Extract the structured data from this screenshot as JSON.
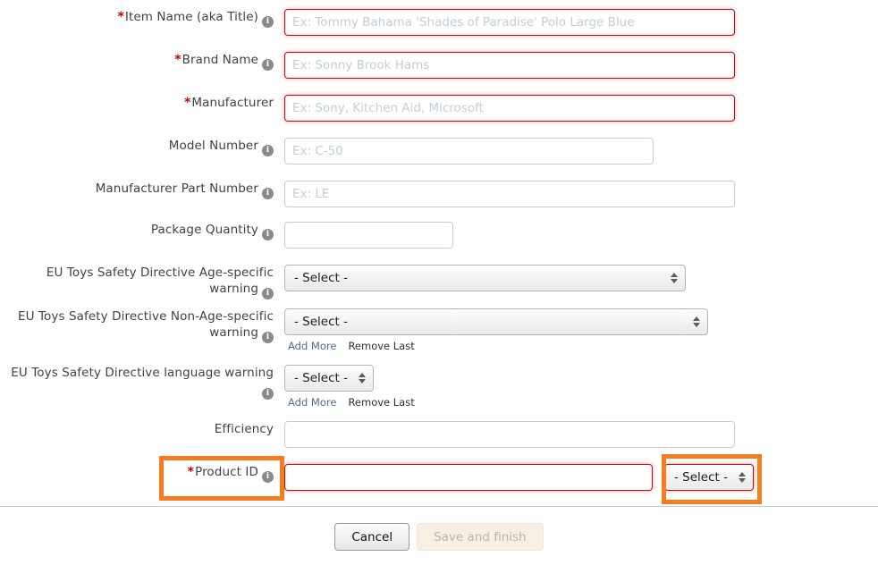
{
  "form": {
    "rows": [
      {
        "id": "item-name",
        "label": "Item Name (aka Title)",
        "required": true,
        "info": true,
        "control": "text",
        "placeholder": "Ex: Tommy Bahama 'Shades of Paradise' Polo Large Blue",
        "value": "",
        "invalid": true
      },
      {
        "id": "brand-name",
        "label": "Brand Name",
        "required": true,
        "info": true,
        "control": "text",
        "placeholder": "Ex: Sonny Brook Hams",
        "value": "",
        "invalid": true
      },
      {
        "id": "manufacturer",
        "label": "Manufacturer",
        "required": true,
        "info": true,
        "control": "text",
        "placeholder": "Ex: Sony, Kitchen Aid, Microsoft",
        "value": "",
        "invalid": true
      },
      {
        "id": "model-number",
        "label": "Model Number",
        "required": false,
        "info": true,
        "control": "text",
        "placeholder": "Ex: C-50",
        "value": "",
        "invalid": false
      },
      {
        "id": "manufacturer-part-number",
        "label": "Manufacturer Part Number",
        "required": false,
        "info": true,
        "control": "text",
        "placeholder": "Ex: LE",
        "value": "",
        "invalid": false
      },
      {
        "id": "package-quantity",
        "label": "Package Quantity",
        "required": false,
        "info": true,
        "control": "text",
        "placeholder": "",
        "value": "",
        "invalid": false
      },
      {
        "id": "eu-toys-age-specific-warning",
        "label": "EU Toys Safety Directive Age-specific warning",
        "required": false,
        "info": true,
        "control": "select",
        "selected": "- Select -",
        "invalid": false
      },
      {
        "id": "eu-toys-non-age-specific-warning",
        "label": "EU Toys Safety Directive Non-Age-specific warning",
        "required": false,
        "info": true,
        "control": "select",
        "selected": "- Select -",
        "invalid": false
      },
      {
        "id": "eu-toys-language-warning",
        "label": "EU Toys Safety Directive language warning",
        "required": false,
        "info": true,
        "control": "select",
        "selected": "- Select -",
        "invalid": false
      },
      {
        "id": "efficiency",
        "label": "Efficiency",
        "required": false,
        "info": false,
        "control": "text",
        "placeholder": "",
        "value": "",
        "invalid": false
      },
      {
        "id": "product-id",
        "label": "Product ID",
        "required": true,
        "info": true,
        "control": "text-with-select",
        "placeholder": "",
        "value": "",
        "selected": "- Select -",
        "invalid": true
      }
    ],
    "repeat_links": {
      "add_more": "Add More",
      "remove_last": "Remove Last"
    }
  },
  "footer": {
    "cancel_label": "Cancel",
    "save_label": "Save and finish"
  },
  "highlight": {
    "color": "#f57c1f"
  }
}
